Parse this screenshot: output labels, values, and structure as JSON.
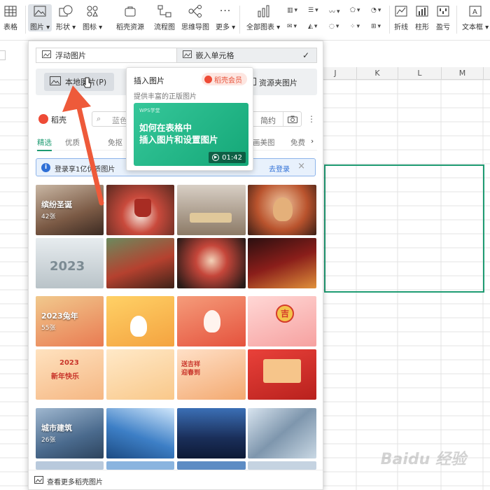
{
  "ribbon": {
    "table": "表格",
    "picture": "图片",
    "shape": "形状",
    "icon": "图标",
    "docer_resource": "稻壳资源",
    "flowchart": "流程图",
    "mindmap": "思维导图",
    "more": "更多",
    "all_charts": "全部图表",
    "line": "折线",
    "column": "柱形",
    "winloss": "盈亏",
    "textbox": "文本框"
  },
  "sheet": {
    "columns": [
      "J",
      "K",
      "L",
      "M"
    ]
  },
  "panel": {
    "floating_picture": "浮动图片",
    "embed_cell": "嵌入单元格",
    "local_picture": "本地图片(P)",
    "resource_folder": "资源夹图片",
    "search_label": "稻壳",
    "search_placeholder_partial": "蓝色",
    "search_partial_right": "简约",
    "tabs": [
      "精选",
      "优质",
      "免抠",
      "画美图",
      "免费"
    ],
    "banner_text": "登录享1亿优质图片",
    "banner_login": "去登录",
    "footer": "查看更多稻壳图片"
  },
  "tooltip": {
    "title": "插入图片",
    "badge": "稻壳会员",
    "subtitle": "提供丰富的正版图片",
    "video_brand": "WPS学堂",
    "video_title_line1": "如何在表格中",
    "video_title_line2": "插入图片和设置图片",
    "duration": "01:42"
  },
  "gallery": {
    "group1_name": "缤纷圣诞",
    "group1_count": "42张",
    "group2_name": "2023兔年",
    "group2_count": "55张",
    "group3_name": "城市建筑",
    "group3_count": "26张",
    "tile_texts": {
      "year2023": "2023",
      "ji": "吉",
      "xinnian": "新年快乐",
      "chunjie": "送吉祥 迎春到"
    }
  },
  "watermark": "Baidu 经验",
  "colors": {
    "accent": "#1e9b72",
    "brand_red": "#ee4b36",
    "arrow": "#ee5a3a"
  }
}
